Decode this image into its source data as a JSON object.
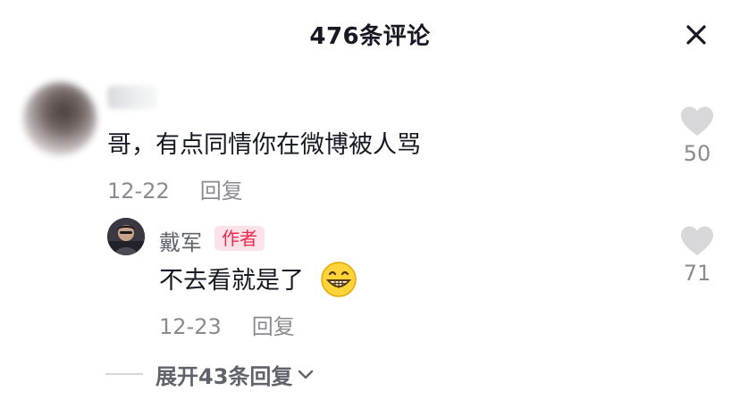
{
  "header": {
    "title": "476条评论",
    "close_icon": "close-icon"
  },
  "comments": [
    {
      "text": "哥，有点同情你在微博被人骂",
      "date": "12-22",
      "reply_label": "回复",
      "likes": "50",
      "like_icon": "heart-icon"
    }
  ],
  "reply": {
    "author": "戴军",
    "badge": "作者",
    "text": "不去看就是了",
    "emoji": "grinning-face-icon",
    "date": "12-23",
    "reply_label": "回复",
    "likes": "71",
    "like_icon": "heart-icon"
  },
  "expand": {
    "label": "展开43条回复",
    "icon": "chevron-down-icon"
  },
  "colors": {
    "text": "#161823",
    "muted": "#8a8b91",
    "heart": "#d8d8da",
    "badge_bg": "#fde3e8",
    "badge_text": "#f2294f"
  }
}
